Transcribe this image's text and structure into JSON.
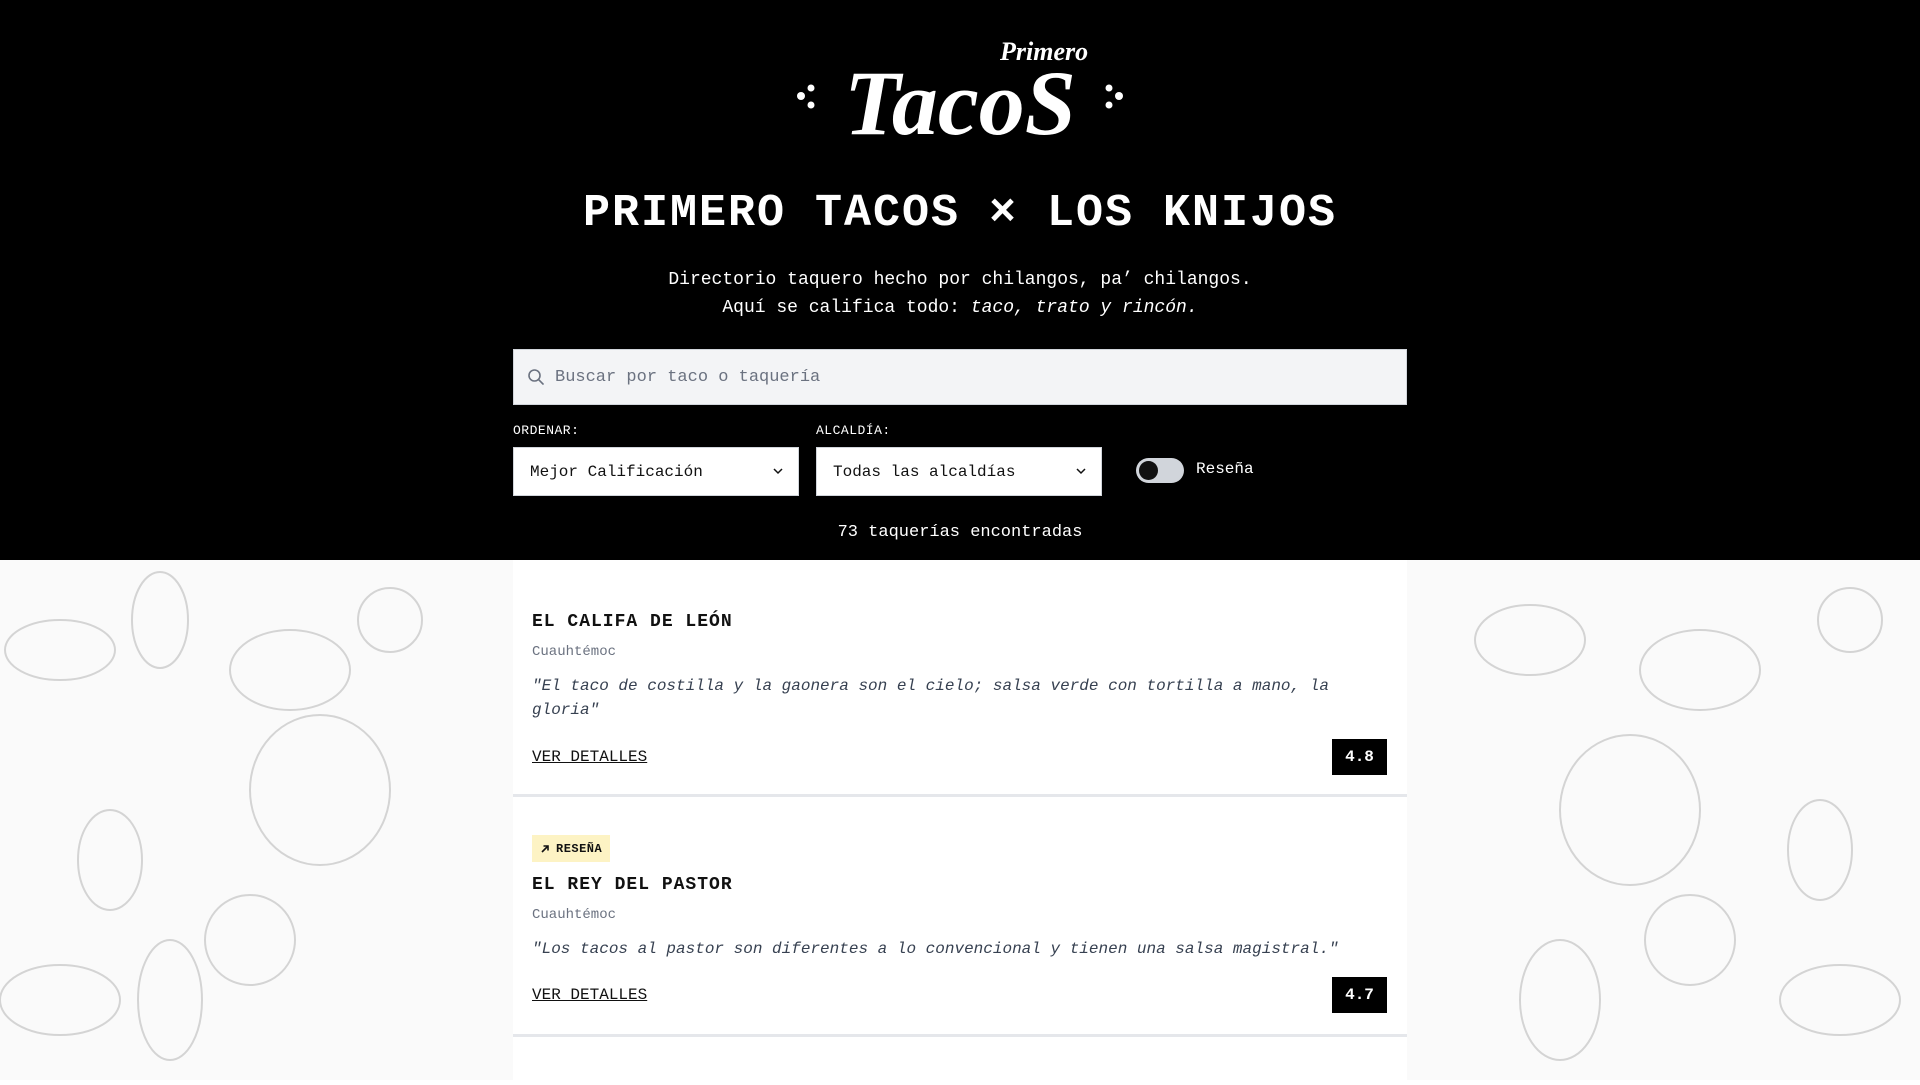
{
  "brand": {
    "logo_small": "Primero",
    "logo_large": "TacoS"
  },
  "header": {
    "headline": "PRIMERO TACOS × LOS KNIJOS",
    "tagline_line1": "Directorio taquero hecho por chilangos, pa’ chilangos.",
    "tagline_line2_prefix": "Aquí se califica todo: ",
    "tagline_line2_emphasis": "taco, trato y rincón."
  },
  "search": {
    "placeholder": "Buscar por taco o taquería",
    "value": ""
  },
  "filters": {
    "sort_label": "ORDENAR:",
    "sort_value": "Mejor Calificación",
    "borough_label": "ALCALDÍA:",
    "borough_value": "Todas las alcaldías",
    "review_toggle_label": "Reseña",
    "review_toggle_on": false
  },
  "results": {
    "count_text": "73 taquerías encontradas"
  },
  "listings": [
    {
      "badge": "",
      "name": "EL CALIFA DE LEÓN",
      "area": "Cuauhtémoc",
      "quote": "\"El taco de costilla y la gaonera son el cielo; salsa verde con tortilla a mano, la gloria\"",
      "details_label": "VER DETALLES",
      "score": "4.8"
    },
    {
      "badge": "RESEÑA",
      "name": "EL REY DEL PASTOR",
      "area": "Cuauhtémoc",
      "quote": "\"Los tacos al pastor son diferentes a lo convencional y tienen una salsa magistral.\"",
      "details_label": "VER DETALLES",
      "score": "4.7"
    }
  ],
  "colors": {
    "header_bg": "#000000",
    "badge_bg": "#fdf3c4",
    "score_bg": "#000000",
    "search_bg": "#f3f4f6"
  },
  "icons": {
    "search": "search-icon",
    "select": "chevron-down-icon",
    "badge": "arrow-up-right-icon"
  }
}
